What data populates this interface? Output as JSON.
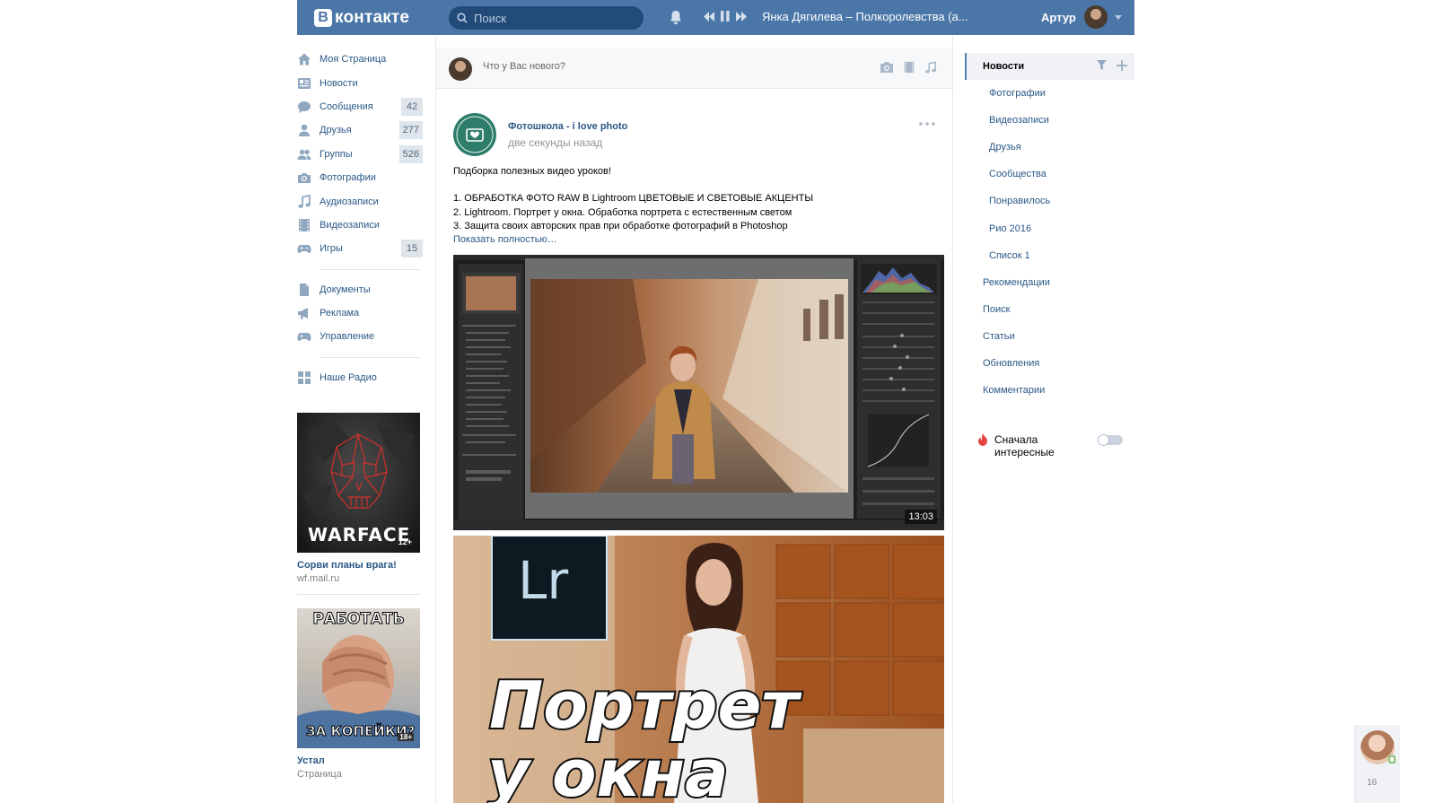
{
  "header": {
    "logo_text": "контакте",
    "logo_letter": "В",
    "search_placeholder": "Поиск",
    "now_playing": "Янка Дягилева – Полкоролевства (а...",
    "user_name": "Артур"
  },
  "leftnav": {
    "items": [
      {
        "label": "Моя Страница",
        "icon": "home-icon"
      },
      {
        "label": "Новости",
        "icon": "news-icon"
      },
      {
        "label": "Сообщения",
        "icon": "messages-icon",
        "count": "42"
      },
      {
        "label": "Друзья",
        "icon": "friends-icon",
        "count": "277"
      },
      {
        "label": "Группы",
        "icon": "groups-icon",
        "count": "526"
      },
      {
        "label": "Фотографии",
        "icon": "camera-icon"
      },
      {
        "label": "Аудиозаписи",
        "icon": "music-icon"
      },
      {
        "label": "Видеозаписи",
        "icon": "film-icon"
      },
      {
        "label": "Игры",
        "icon": "gamepad-icon",
        "count": "15"
      }
    ],
    "items2": [
      {
        "label": "Документы",
        "icon": "document-icon"
      },
      {
        "label": "Реклама",
        "icon": "megaphone-icon"
      },
      {
        "label": "Управление",
        "icon": "gamepad-icon"
      }
    ],
    "items3": [
      {
        "label": "Наше Радио",
        "icon": "apps-icon"
      }
    ]
  },
  "ads": [
    {
      "title": "Сорви планы врага!",
      "subtitle": "wf.mail.ru",
      "image_text": "WARFACE",
      "badge": "12+"
    },
    {
      "title": "Устал",
      "subtitle": "Страница",
      "image_text_top": "РАБОТАТЬ",
      "image_text_bottom": "ЗА КОПЕЙКИ?",
      "badge": "18+"
    }
  ],
  "composer": {
    "placeholder": "Что у Вас нового?"
  },
  "post": {
    "author": "Фотошкола - i love photo",
    "time": "две секунды назад",
    "lines": [
      "Подборка полезных видео уроков!",
      "",
      "1. ОБРАБОТКА ФОТО RAW В Lightroom ЦВЕТОВЫЕ И СВЕТОВЫЕ АКЦЕНТЫ",
      "2. Lightroom. Портрет у окна. Обработка портрета с естественным светом",
      "3. Защита своих авторских прав при обработке фотографий в Photoshop"
    ],
    "show_more": "Показать полностью…",
    "video1_duration": "13:03",
    "video2_logo": "Lr",
    "video2_title_line1": "Портрет",
    "video2_title_line2": "у окна"
  },
  "rightnav": {
    "active": "Новости",
    "sub_items": [
      "Фотографии",
      "Видеозаписи",
      "Друзья",
      "Сообщества",
      "Понравилось",
      "Рио 2016",
      "Список 1"
    ],
    "top_items": [
      "Рекомендации",
      "Поиск",
      "Статьи",
      "Обновления",
      "Комментарии"
    ],
    "interest_label": "Сначала интересные",
    "interest_on": false
  },
  "chat": {
    "count": "16"
  },
  "colors": {
    "header": "#4a76a8",
    "link": "#2a5885",
    "accent": "#5181b8"
  }
}
